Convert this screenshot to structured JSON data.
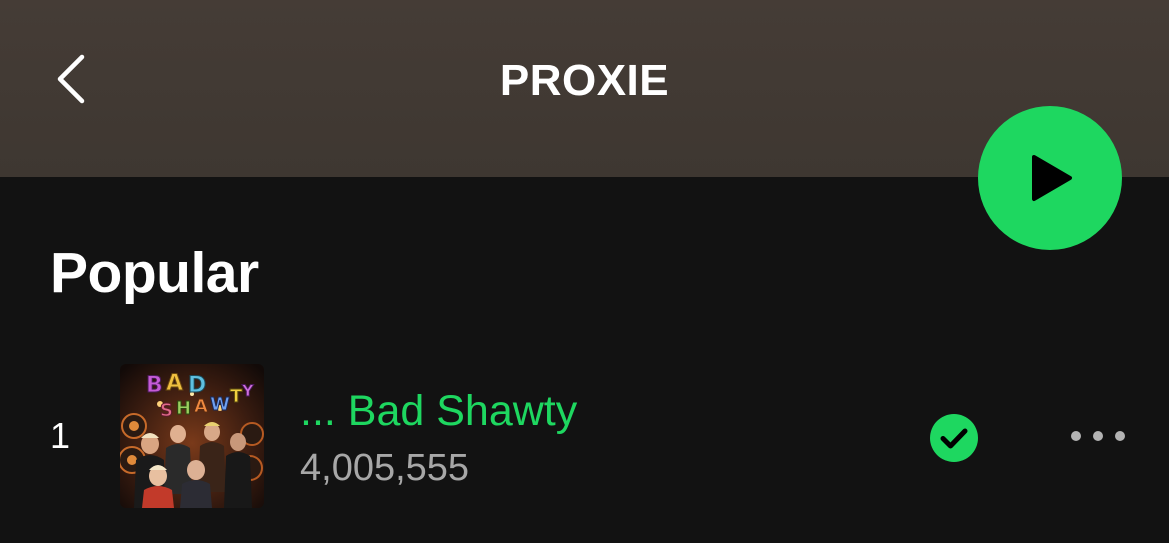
{
  "header": {
    "title": "PROXIE",
    "back_icon": "chevron-left-icon"
  },
  "play_button": {
    "icon": "play-icon",
    "color": "#1ed760"
  },
  "section": {
    "title": "Popular"
  },
  "tracks": [
    {
      "number": "1",
      "title": "... Bad Shawty",
      "plays": "4,005,555",
      "saved": true,
      "saved_icon": "check-circle-icon",
      "more_icon": "more-horizontal-icon",
      "artwork_text": "BAD SHAWTY"
    }
  ],
  "colors": {
    "accent": "#1ed760",
    "background": "#121212",
    "header": "#443b35",
    "secondary_text": "#a7a7a7"
  }
}
